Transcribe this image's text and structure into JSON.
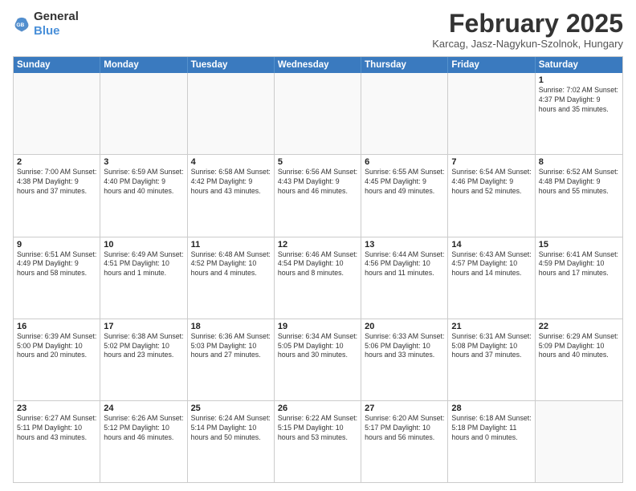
{
  "header": {
    "logo_general": "General",
    "logo_blue": "Blue",
    "month_year": "February 2025",
    "location": "Karcag, Jasz-Nagykun-Szolnok, Hungary"
  },
  "days_of_week": [
    "Sunday",
    "Monday",
    "Tuesday",
    "Wednesday",
    "Thursday",
    "Friday",
    "Saturday"
  ],
  "weeks": [
    [
      {
        "day": "",
        "info": ""
      },
      {
        "day": "",
        "info": ""
      },
      {
        "day": "",
        "info": ""
      },
      {
        "day": "",
        "info": ""
      },
      {
        "day": "",
        "info": ""
      },
      {
        "day": "",
        "info": ""
      },
      {
        "day": "1",
        "info": "Sunrise: 7:02 AM\nSunset: 4:37 PM\nDaylight: 9 hours and 35 minutes."
      }
    ],
    [
      {
        "day": "2",
        "info": "Sunrise: 7:00 AM\nSunset: 4:38 PM\nDaylight: 9 hours and 37 minutes."
      },
      {
        "day": "3",
        "info": "Sunrise: 6:59 AM\nSunset: 4:40 PM\nDaylight: 9 hours and 40 minutes."
      },
      {
        "day": "4",
        "info": "Sunrise: 6:58 AM\nSunset: 4:42 PM\nDaylight: 9 hours and 43 minutes."
      },
      {
        "day": "5",
        "info": "Sunrise: 6:56 AM\nSunset: 4:43 PM\nDaylight: 9 hours and 46 minutes."
      },
      {
        "day": "6",
        "info": "Sunrise: 6:55 AM\nSunset: 4:45 PM\nDaylight: 9 hours and 49 minutes."
      },
      {
        "day": "7",
        "info": "Sunrise: 6:54 AM\nSunset: 4:46 PM\nDaylight: 9 hours and 52 minutes."
      },
      {
        "day": "8",
        "info": "Sunrise: 6:52 AM\nSunset: 4:48 PM\nDaylight: 9 hours and 55 minutes."
      }
    ],
    [
      {
        "day": "9",
        "info": "Sunrise: 6:51 AM\nSunset: 4:49 PM\nDaylight: 9 hours and 58 minutes."
      },
      {
        "day": "10",
        "info": "Sunrise: 6:49 AM\nSunset: 4:51 PM\nDaylight: 10 hours and 1 minute."
      },
      {
        "day": "11",
        "info": "Sunrise: 6:48 AM\nSunset: 4:52 PM\nDaylight: 10 hours and 4 minutes."
      },
      {
        "day": "12",
        "info": "Sunrise: 6:46 AM\nSunset: 4:54 PM\nDaylight: 10 hours and 8 minutes."
      },
      {
        "day": "13",
        "info": "Sunrise: 6:44 AM\nSunset: 4:56 PM\nDaylight: 10 hours and 11 minutes."
      },
      {
        "day": "14",
        "info": "Sunrise: 6:43 AM\nSunset: 4:57 PM\nDaylight: 10 hours and 14 minutes."
      },
      {
        "day": "15",
        "info": "Sunrise: 6:41 AM\nSunset: 4:59 PM\nDaylight: 10 hours and 17 minutes."
      }
    ],
    [
      {
        "day": "16",
        "info": "Sunrise: 6:39 AM\nSunset: 5:00 PM\nDaylight: 10 hours and 20 minutes."
      },
      {
        "day": "17",
        "info": "Sunrise: 6:38 AM\nSunset: 5:02 PM\nDaylight: 10 hours and 23 minutes."
      },
      {
        "day": "18",
        "info": "Sunrise: 6:36 AM\nSunset: 5:03 PM\nDaylight: 10 hours and 27 minutes."
      },
      {
        "day": "19",
        "info": "Sunrise: 6:34 AM\nSunset: 5:05 PM\nDaylight: 10 hours and 30 minutes."
      },
      {
        "day": "20",
        "info": "Sunrise: 6:33 AM\nSunset: 5:06 PM\nDaylight: 10 hours and 33 minutes."
      },
      {
        "day": "21",
        "info": "Sunrise: 6:31 AM\nSunset: 5:08 PM\nDaylight: 10 hours and 37 minutes."
      },
      {
        "day": "22",
        "info": "Sunrise: 6:29 AM\nSunset: 5:09 PM\nDaylight: 10 hours and 40 minutes."
      }
    ],
    [
      {
        "day": "23",
        "info": "Sunrise: 6:27 AM\nSunset: 5:11 PM\nDaylight: 10 hours and 43 minutes."
      },
      {
        "day": "24",
        "info": "Sunrise: 6:26 AM\nSunset: 5:12 PM\nDaylight: 10 hours and 46 minutes."
      },
      {
        "day": "25",
        "info": "Sunrise: 6:24 AM\nSunset: 5:14 PM\nDaylight: 10 hours and 50 minutes."
      },
      {
        "day": "26",
        "info": "Sunrise: 6:22 AM\nSunset: 5:15 PM\nDaylight: 10 hours and 53 minutes."
      },
      {
        "day": "27",
        "info": "Sunrise: 6:20 AM\nSunset: 5:17 PM\nDaylight: 10 hours and 56 minutes."
      },
      {
        "day": "28",
        "info": "Sunrise: 6:18 AM\nSunset: 5:18 PM\nDaylight: 11 hours and 0 minutes."
      },
      {
        "day": "",
        "info": ""
      }
    ]
  ]
}
